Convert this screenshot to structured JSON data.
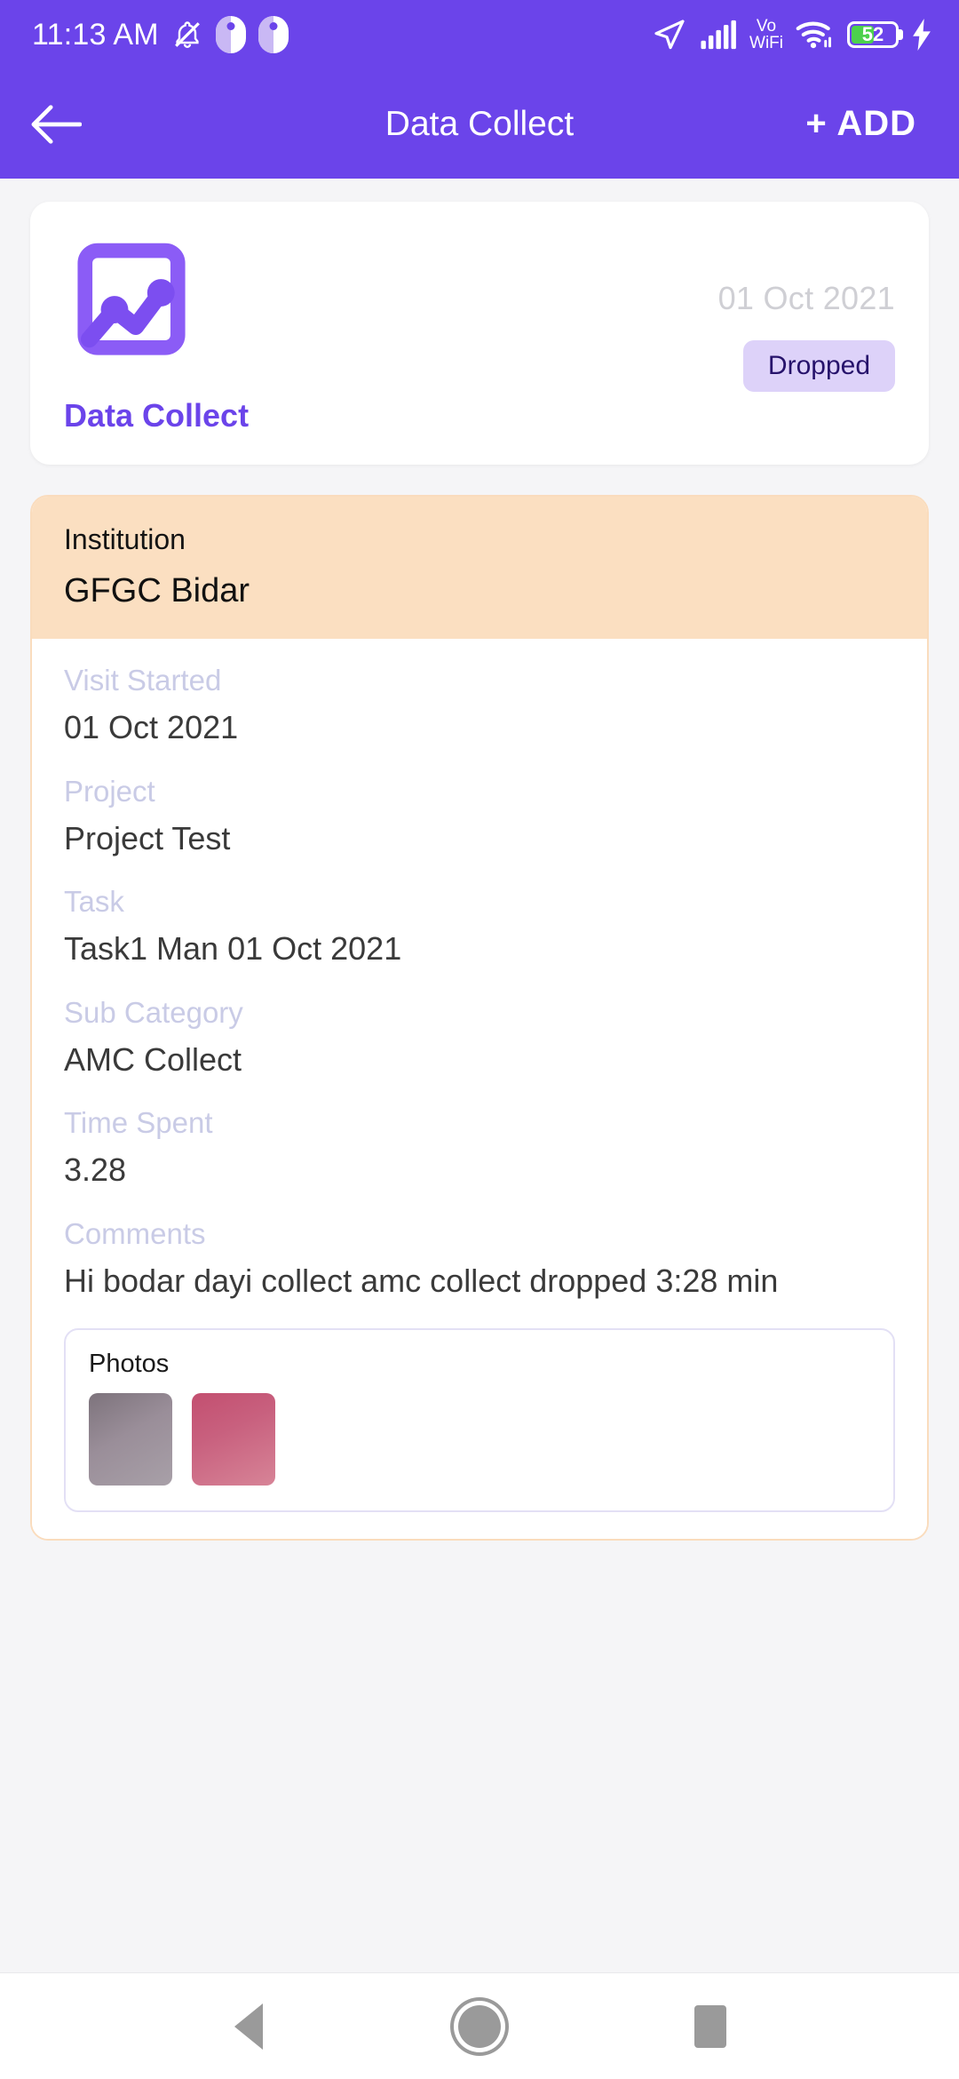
{
  "status_bar": {
    "time": "11:13 AM",
    "icons_left": [
      "do-not-disturb-icon",
      "dnd-pill-icon",
      "dnd-pill-icon-2"
    ],
    "icons_right": [
      "location-arrow-icon",
      "signal-bars-icon",
      "vowifi-icon",
      "wifi-icon",
      "battery-icon",
      "charging-bolt-icon"
    ],
    "vowifi_line1": "Vo",
    "vowifi_line2": "WiFi",
    "battery_percent": "52",
    "battery_level": 52,
    "charging": true
  },
  "app_bar": {
    "back_icon": "arrow-left-icon",
    "title": "Data Collect",
    "add_label": "+ ADD",
    "background_color": "#6b44ea"
  },
  "summary_card": {
    "icon": "chart-analytics-icon",
    "title": "Data Collect",
    "date": "01 Oct 2021",
    "status": "Dropped",
    "status_bg": "#ddd2f9",
    "status_color": "#26126b",
    "title_color": "#6b44ea"
  },
  "detail_card": {
    "header": {
      "label": "Institution",
      "value": "GFGC Bidar",
      "background_color": "#fbdfc1"
    },
    "fields": [
      {
        "label": "Visit Started",
        "value": "01 Oct 2021"
      },
      {
        "label": "Project",
        "value": "Project Test"
      },
      {
        "label": "Task",
        "value": "Task1 Man 01 Oct 2021"
      },
      {
        "label": "Sub Category",
        "value": "AMC Collect"
      },
      {
        "label": "Time Spent",
        "value": "3.28"
      },
      {
        "label": "Comments",
        "value": "Hi bodar dayi collect amc collect dropped 3:28 min"
      }
    ],
    "photos": {
      "label": "Photos",
      "items": [
        {
          "name": "photo-thumbnail-1",
          "color": "#9a8e99"
        },
        {
          "name": "photo-thumbnail-2",
          "color": "#c8607e"
        }
      ]
    },
    "border_color": "#fadcbd"
  },
  "nav_bar": {
    "back": "nav-back-icon",
    "home": "nav-home-icon",
    "recents": "nav-recents-icon"
  }
}
